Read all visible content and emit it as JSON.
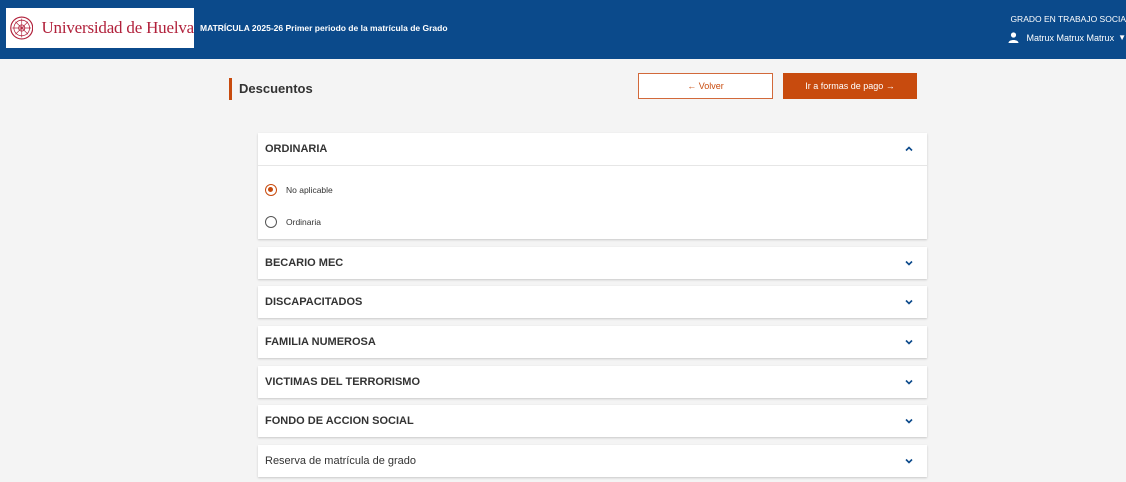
{
  "header": {
    "university_name": "Universidad de Huelva",
    "app_title": "MATRÍCULA 2025-26 Primer periodo de la matrícula de Grado",
    "degree": "GRADO EN TRABAJO SOCIA",
    "user_name": "Matrux Matrux Matrux",
    "colors": {
      "bar": "#0b4a8b",
      "brand_red": "#b1213b"
    },
    "icons": [
      "university-seal",
      "user-icon",
      "caret-down-icon"
    ]
  },
  "page": {
    "title": "Descuentos",
    "back_label": "← Volver",
    "pay_label": "Ir a formas de pago →",
    "accent_color": "#c84b0e"
  },
  "accordion": {
    "open": {
      "title": "ORDINARIA",
      "options": [
        {
          "label": "No aplicable",
          "selected": true
        },
        {
          "label": "Ordinaria",
          "selected": false
        }
      ]
    },
    "closed": [
      "BECARIO MEC",
      "DISCAPACITADOS",
      "FAMILIA NUMEROSA",
      "VICTIMAS DEL TERRORISMO",
      "FONDO DE ACCION SOCIAL",
      "Reserva de matrícula de grado"
    ]
  }
}
